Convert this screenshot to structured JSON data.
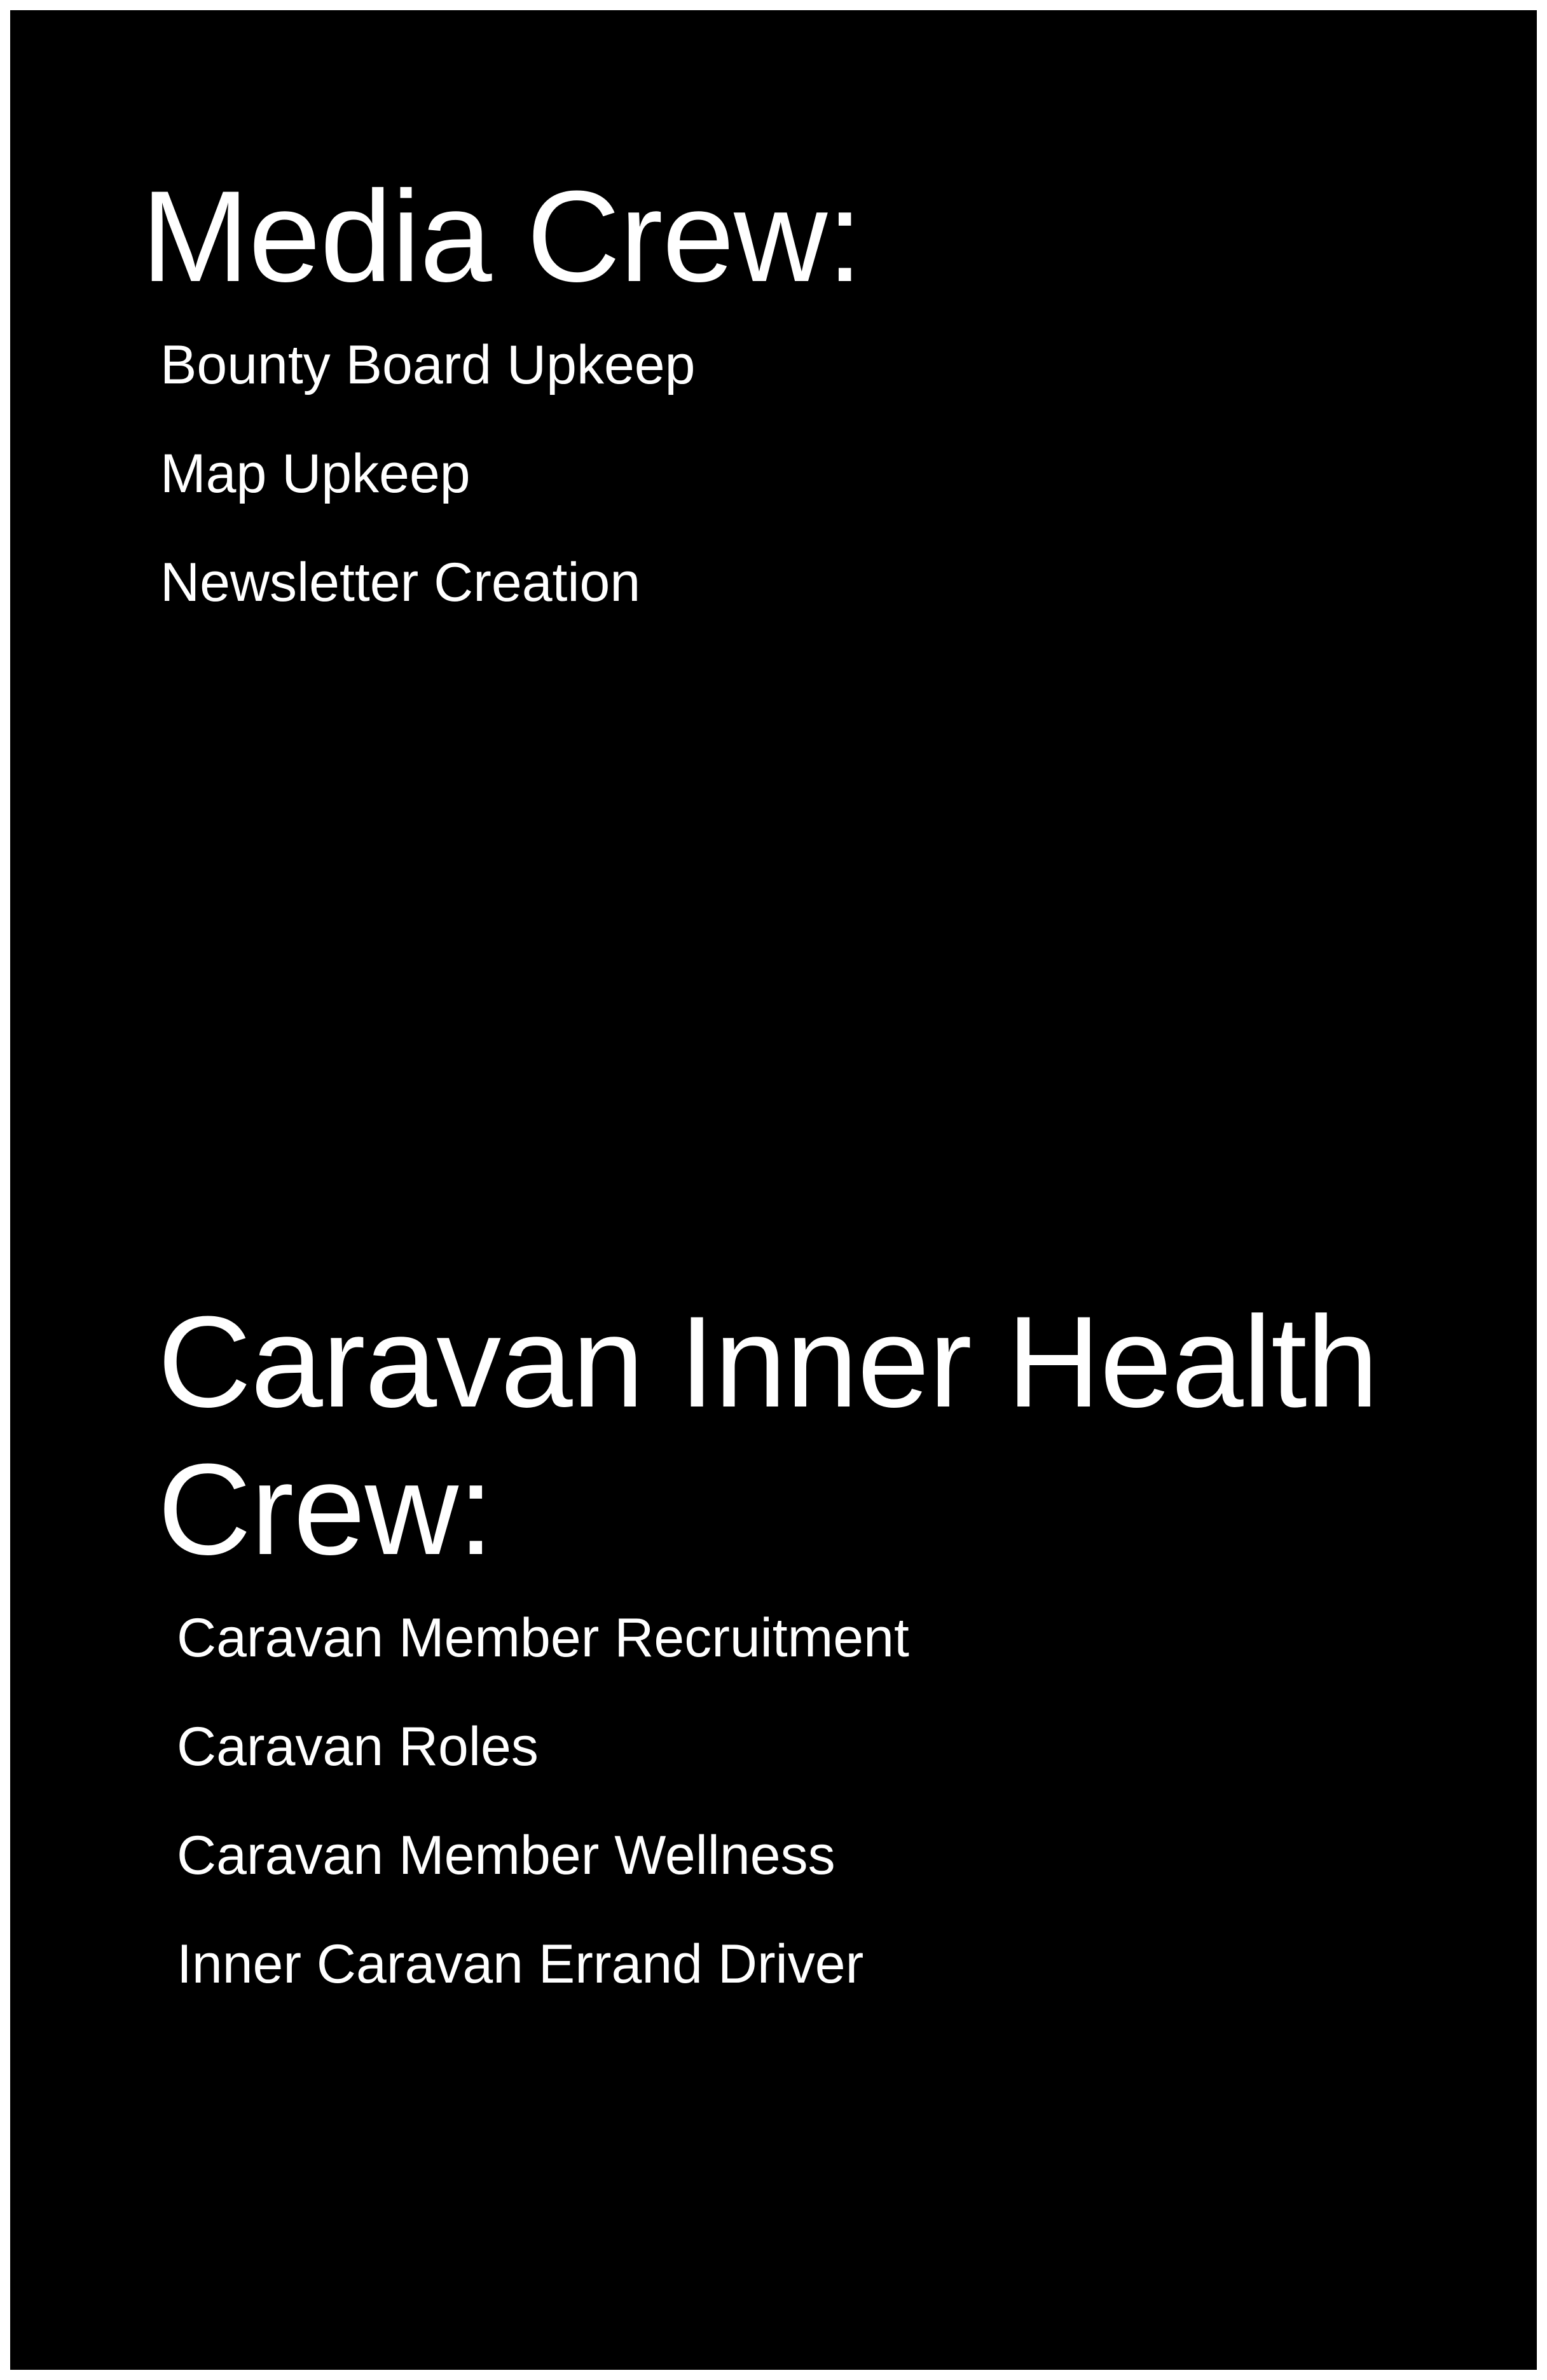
{
  "sections": [
    {
      "title": "Media Crew:",
      "items": [
        "Bounty Board Upkeep",
        "Map Upkeep",
        "Newsletter Creation"
      ]
    },
    {
      "title": "Caravan Inner Health\nCrew:",
      "items": [
        "Caravan Member Recruitment",
        "Caravan Roles",
        "Caravan Member Wellness",
        "Inner Caravan Errand Driver"
      ]
    }
  ],
  "colors": {
    "background": "#000000",
    "text": "#ffffff",
    "border": "#ffffff"
  }
}
